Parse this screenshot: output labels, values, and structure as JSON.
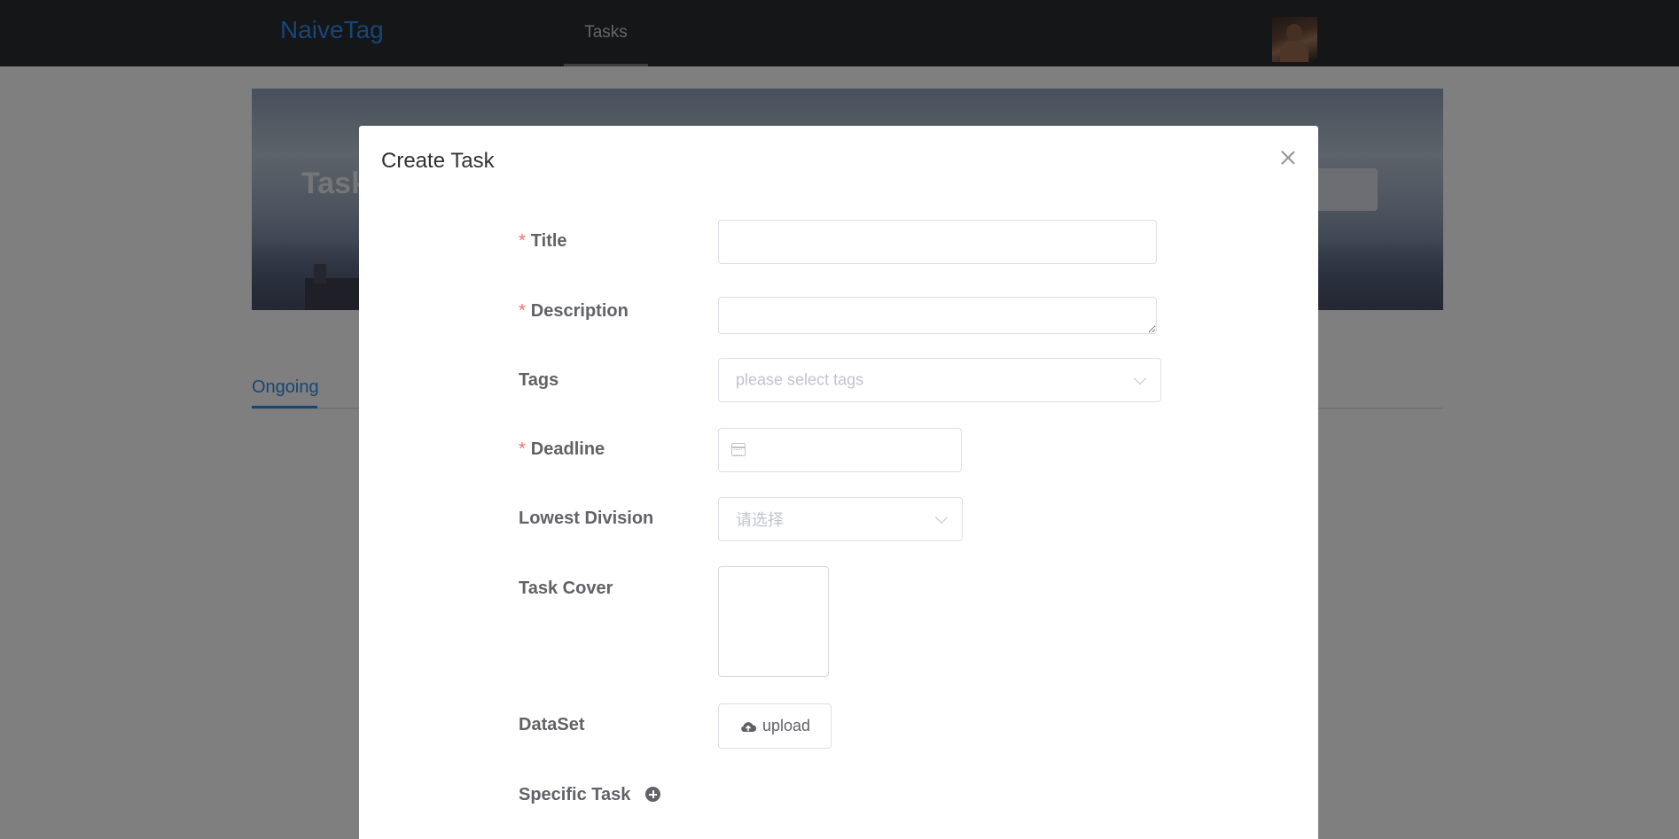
{
  "header": {
    "brand": "NaiveTag",
    "nav_tab": "Tasks"
  },
  "page": {
    "banner_title": "Task",
    "active_tab": "Ongoing"
  },
  "modal": {
    "title": "Create Task",
    "fields": {
      "title": {
        "label": "Title",
        "required_mark": "*",
        "value": ""
      },
      "description": {
        "label": "Description",
        "required_mark": "*",
        "value": ""
      },
      "tags": {
        "label": "Tags",
        "placeholder": "please select tags"
      },
      "deadline": {
        "label": "Deadline",
        "required_mark": "*",
        "value": ""
      },
      "lowest_division": {
        "label": "Lowest Division",
        "placeholder": "请选择"
      },
      "task_cover": {
        "label": "Task Cover"
      },
      "dataset": {
        "label": "DataSet",
        "button_label": "upload"
      },
      "specific_task": {
        "label": "Specific Task"
      }
    }
  },
  "colors": {
    "brand": "#2d8cf0",
    "required": "#f56c6c",
    "topbar": "#2b2c2e"
  }
}
